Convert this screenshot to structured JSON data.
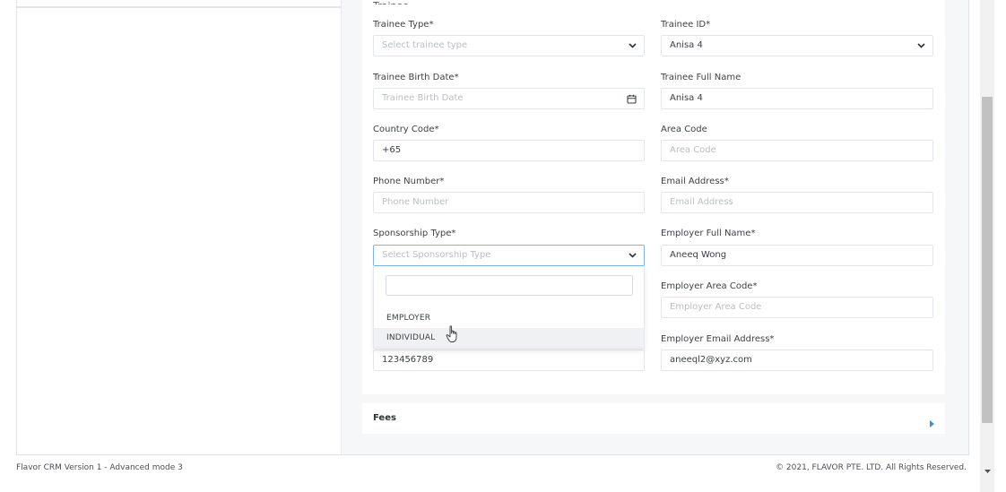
{
  "section": {
    "title_stub": "Trainee"
  },
  "form": {
    "trainee_type": {
      "label": "Trainee Type*",
      "placeholder": "Select trainee type"
    },
    "trainee_id": {
      "label": "Trainee ID*",
      "value": "Anisa 4"
    },
    "trainee_birth_date": {
      "label": "Trainee Birth Date*",
      "placeholder": "Trainee Birth Date"
    },
    "trainee_full_name": {
      "label": "Trainee Full Name",
      "value": "Anisa 4"
    },
    "country_code": {
      "label": "Country Code*",
      "value": "+65"
    },
    "area_code": {
      "label": "Area Code",
      "placeholder": "Area Code"
    },
    "phone_number": {
      "label": "Phone Number*",
      "placeholder": "Phone Number"
    },
    "email_address": {
      "label": "Email Address*",
      "placeholder": "Email Address"
    },
    "sponsorship_type": {
      "label": "Sponsorship Type*",
      "placeholder": "Select Sponsorship Type",
      "options": [
        "EMPLOYER",
        "INDIVIDUAL"
      ]
    },
    "employer_full_name": {
      "label": "Employer Full Name*",
      "value": "Aneeq Wong"
    },
    "employer_area_code": {
      "label": "Employer Area Code*",
      "placeholder": "Employer Area Code"
    },
    "employer_phone": {
      "value": "123456789"
    },
    "employer_email": {
      "label": "Employer Email Address*",
      "value": "aneeql2@xyz.com"
    }
  },
  "fees": {
    "title": "Fees"
  },
  "footer": {
    "left": "Flavor CRM Version 1 - Advanced mode 3",
    "right": "© 2021, FLAVOR PTE. LTD. All Rights Reserved."
  },
  "colors": {
    "accent": "#3b8fe0",
    "focus_border": "#7fb2e5"
  },
  "icons": {
    "chevron": "chevron-down-icon",
    "calendar": "calendar-icon",
    "arrow": "caret-right-icon",
    "cursor": "hand-pointer-icon"
  }
}
